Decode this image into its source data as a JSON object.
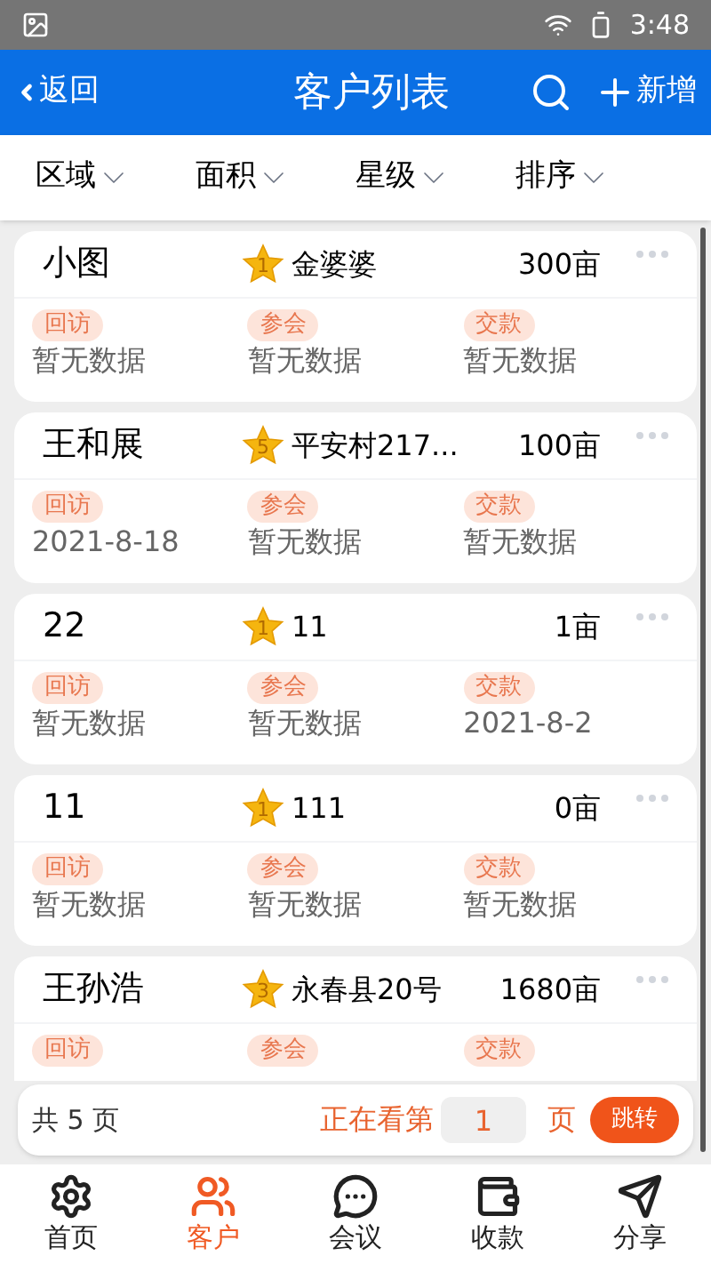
{
  "status_bar": {
    "time": "3:48"
  },
  "header": {
    "back": "返回",
    "title": "客户列表",
    "add": "新增"
  },
  "filters": [
    {
      "label": "区域"
    },
    {
      "label": "面积"
    },
    {
      "label": "星级"
    },
    {
      "label": "排序"
    }
  ],
  "customers": [
    {
      "name": "小图",
      "grade": "1",
      "place": "金婆婆",
      "area": "300亩",
      "fields": [
        {
          "label": "回访",
          "value": "暂无数据"
        },
        {
          "label": "参会",
          "value": "暂无数据"
        },
        {
          "label": "交款",
          "value": "暂无数据"
        }
      ]
    },
    {
      "name": "王和展",
      "grade": "5",
      "place": "平安村217...",
      "area": "100亩",
      "fields": [
        {
          "label": "回访",
          "value": "2021-8-18"
        },
        {
          "label": "参会",
          "value": "暂无数据"
        },
        {
          "label": "交款",
          "value": "暂无数据"
        }
      ]
    },
    {
      "name": "22",
      "grade": "1",
      "place": "11",
      "area": "1亩",
      "fields": [
        {
          "label": "回访",
          "value": "暂无数据"
        },
        {
          "label": "参会",
          "value": "暂无数据"
        },
        {
          "label": "交款",
          "value": "2021-8-2"
        }
      ]
    },
    {
      "name": "11",
      "grade": "1",
      "place": "111",
      "area": "0亩",
      "fields": [
        {
          "label": "回访",
          "value": "暂无数据"
        },
        {
          "label": "参会",
          "value": "暂无数据"
        },
        {
          "label": "交款",
          "value": "暂无数据"
        }
      ]
    },
    {
      "name": "王孙浩",
      "grade": "3",
      "place": "永春县20号",
      "area": "1680亩",
      "fields": [
        {
          "label": "回访"
        },
        {
          "label": "参会"
        },
        {
          "label": "交款"
        }
      ]
    }
  ],
  "pager": {
    "total": "共 5 页",
    "current_label": "正在看第",
    "page": "1",
    "unit": "页",
    "jump": "跳转"
  },
  "tabs": [
    {
      "label": "首页",
      "kind": "gear",
      "selected": false
    },
    {
      "label": "客户",
      "kind": "people",
      "selected": true
    },
    {
      "label": "会议",
      "kind": "chat",
      "selected": false
    },
    {
      "label": "收款",
      "kind": "wallet",
      "selected": false
    },
    {
      "label": "分享",
      "kind": "send",
      "selected": false
    }
  ]
}
